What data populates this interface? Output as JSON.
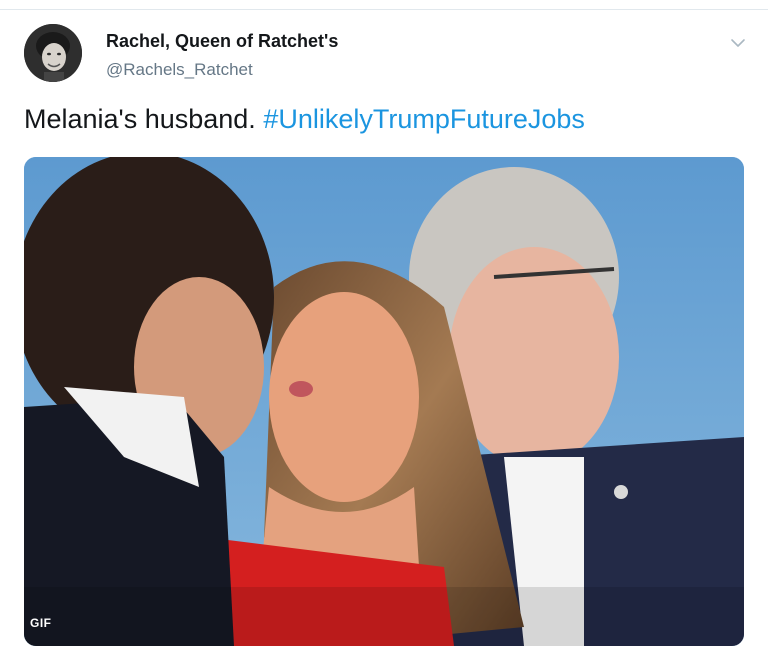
{
  "tweet": {
    "author_name": "Rachel, Queen of Ratchet's",
    "author_handle": "@Rachels_Ratchet",
    "text_plain": "Melania's husband. ",
    "hashtag": "#UnlikelyTrumpFutureJobs",
    "media_badge": "GIF"
  },
  "icons": {
    "menu": "chevron-down-icon",
    "avatar": "avatar-photo"
  },
  "colors": {
    "link": "#1b95e0",
    "secondary_text": "#657786",
    "primary_text": "#14171a"
  }
}
